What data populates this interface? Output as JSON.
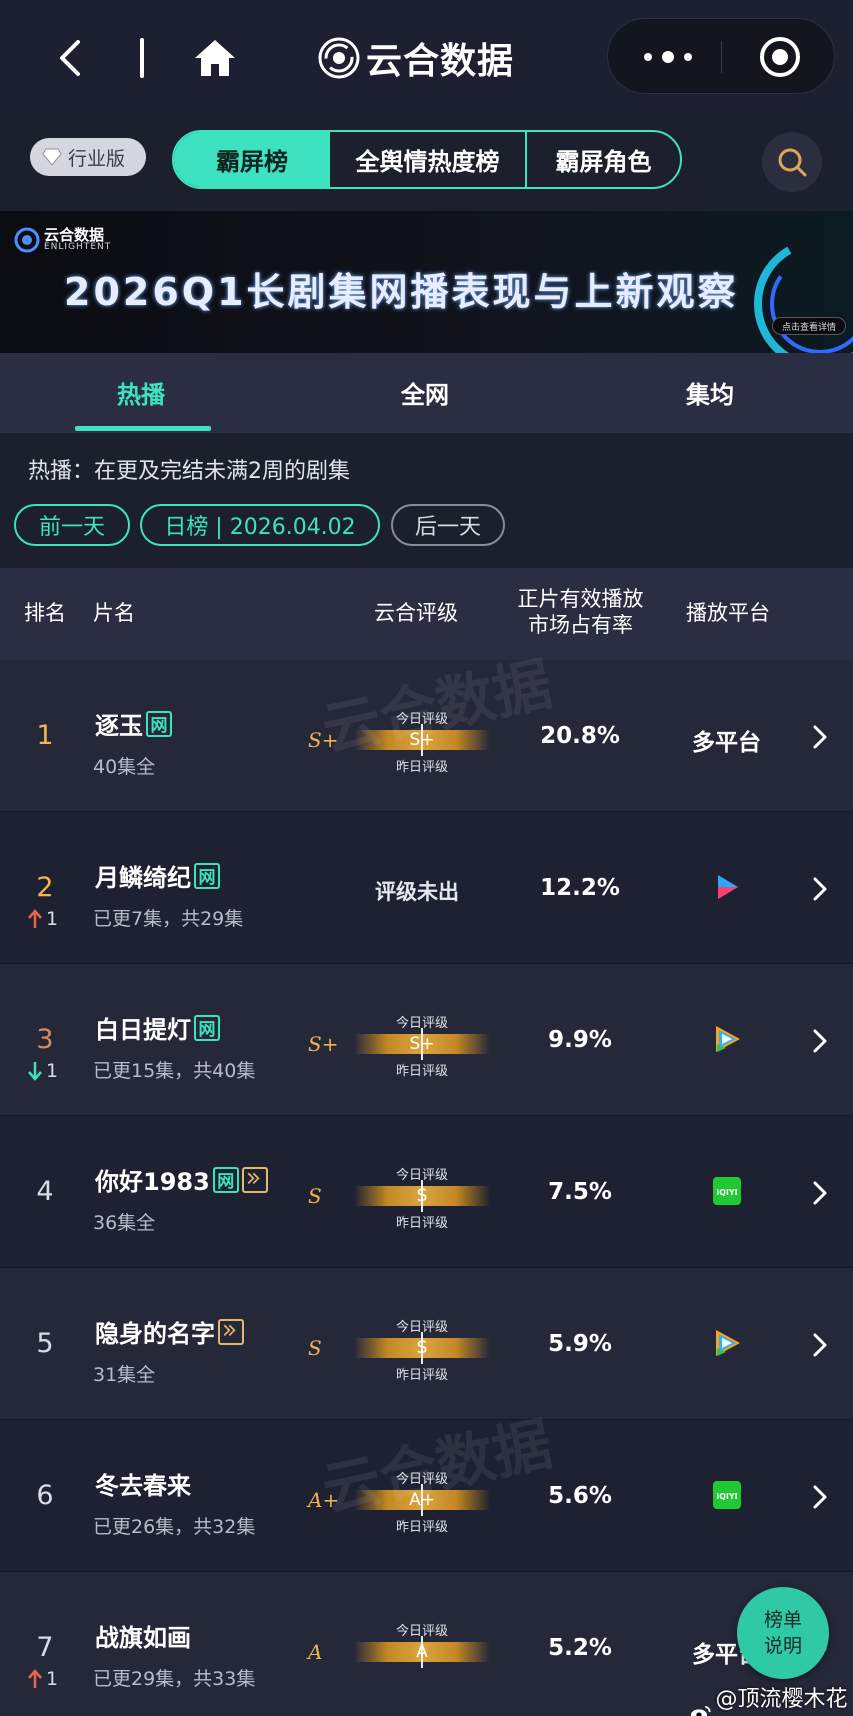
{
  "nav": {
    "app_title": "云合数据"
  },
  "edition_badge": "行业版",
  "main_tabs": [
    {
      "label": "霸屏榜",
      "active": true
    },
    {
      "label": "全舆情热度榜",
      "active": false
    },
    {
      "label": "霸屏角色",
      "active": false
    }
  ],
  "banner": {
    "brand_cn": "云合数据",
    "brand_en": "ENLIGHTENT",
    "headline": "2026Q1长剧集网播表现与上新观察",
    "cta": "点击查看详情"
  },
  "sub_tabs": [
    {
      "label": "热播",
      "active": true
    },
    {
      "label": "全网",
      "active": false
    },
    {
      "label": "集均",
      "active": false
    }
  ],
  "note": "热播：在更及完结未满2周的剧集",
  "date_nav": {
    "prev": "前一天",
    "current": "日榜 | 2026.04.02",
    "next": "后一天"
  },
  "table": {
    "headers": {
      "rank": "排名",
      "title": "片名",
      "grade": "云合评级",
      "share_line1": "正片有效播放",
      "share_line2": "市场占有率",
      "platform": "播放平台"
    },
    "grade_label_today": "今日评级",
    "grade_label_yesterday": "昨日评级",
    "grade_pending": "评级未出",
    "rows": [
      {
        "rank": "1",
        "title": "逐玉",
        "net_badge": "网",
        "play_badge": false,
        "episodes": "40集全",
        "grade": "S+",
        "grade_today": "S+",
        "share": "20.8%",
        "platform": "多平台",
        "platform_icon": "",
        "trend": "",
        "trend_value": ""
      },
      {
        "rank": "2",
        "title": "月鳞绮纪",
        "net_badge": "网",
        "play_badge": false,
        "episodes": "已更7集，共29集",
        "grade": "",
        "grade_today": "",
        "share": "12.2%",
        "platform": "",
        "platform_icon": "youku-icon",
        "trend": "up",
        "trend_value": "1"
      },
      {
        "rank": "3",
        "title": "白日提灯",
        "net_badge": "网",
        "play_badge": false,
        "episodes": "已更15集，共40集",
        "grade": "S+",
        "grade_today": "S+",
        "share": "9.9%",
        "platform": "",
        "platform_icon": "tencent-video-icon",
        "trend": "down",
        "trend_value": "1"
      },
      {
        "rank": "4",
        "title": "你好1983",
        "net_badge": "网",
        "play_badge": true,
        "episodes": "36集全",
        "grade": "S",
        "grade_today": "S",
        "share": "7.5%",
        "platform": "",
        "platform_icon": "iqiyi-icon",
        "trend": "",
        "trend_value": ""
      },
      {
        "rank": "5",
        "title": "隐身的名字",
        "net_badge": "",
        "play_badge": true,
        "episodes": "31集全",
        "grade": "S",
        "grade_today": "S",
        "share": "5.9%",
        "platform": "",
        "platform_icon": "tencent-video-icon",
        "trend": "",
        "trend_value": ""
      },
      {
        "rank": "6",
        "title": "冬去春来",
        "net_badge": "",
        "play_badge": false,
        "episodes": "已更26集，共32集",
        "grade": "A+",
        "grade_today": "A+",
        "share": "5.6%",
        "platform": "",
        "platform_icon": "iqiyi-icon",
        "trend": "",
        "trend_value": ""
      },
      {
        "rank": "7",
        "title": "战旗如画",
        "net_badge": "",
        "play_badge": false,
        "episodes": "已更29集，共33集",
        "grade": "A",
        "grade_today": "A",
        "share": "5.2%",
        "platform": "多平台",
        "platform_icon": "",
        "trend": "up",
        "trend_value": "1"
      }
    ]
  },
  "float_button": {
    "line1": "榜单",
    "line2": "说明"
  },
  "credit": "@顶流樱木花道",
  "watermark": "云合数据",
  "colors": {
    "accent": "#3de3c0",
    "rank_gold": "#f1b54a",
    "up": "#e8674a",
    "down": "#3de3c0"
  }
}
